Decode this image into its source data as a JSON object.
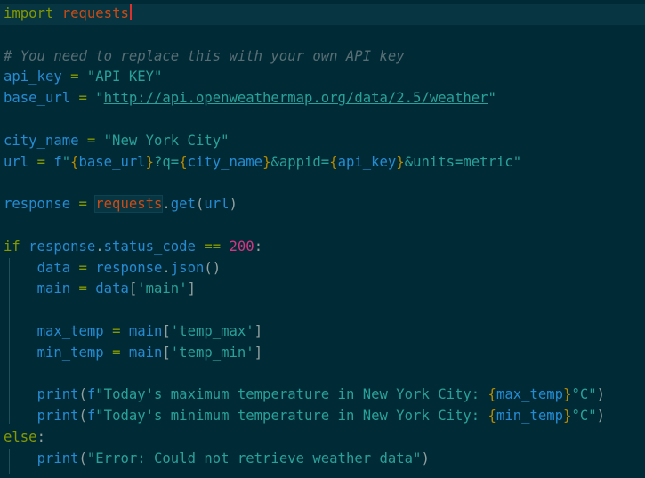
{
  "editor": {
    "line1": {
      "kw": "import",
      "module": "requests"
    },
    "line3": {
      "comment": "# You need to replace this with your own API key"
    },
    "line4": {
      "var": "api_key",
      "op": "=",
      "value": "\"API KEY\""
    },
    "line5": {
      "var": "base_url",
      "op": "=",
      "q1": "\"",
      "url": "http://api.openweathermap.org/data/2.5/weather",
      "q2": "\""
    },
    "line7": {
      "var": "city_name",
      "op": "=",
      "value": "\"New York City\""
    },
    "line8": {
      "var": "url",
      "op": "=",
      "prefix": "f",
      "s1": "\"",
      "b1o": "{",
      "v1": "base_url",
      "b1c": "}",
      "s2": "?q=",
      "b2o": "{",
      "v2": "city_name",
      "b2c": "}",
      "s3": "&appid=",
      "b3o": "{",
      "v3": "api_key",
      "b3c": "}",
      "s4": "&units=metric\""
    },
    "line10": {
      "var": "response",
      "op": "=",
      "module": "requests",
      "dot": ".",
      "fn": "get",
      "po": "(",
      "arg": "url",
      "pc": ")"
    },
    "line12": {
      "kw": "if",
      "obj": "response",
      "dot": ".",
      "attr": "status_code",
      "op": "==",
      "num": "200",
      "colon": ":"
    },
    "line13": {
      "var": "data",
      "op": "=",
      "obj": "response",
      "dot": ".",
      "fn": "json",
      "parens": "()"
    },
    "line14": {
      "var": "main",
      "op": "=",
      "obj": "data",
      "bo": "[",
      "key": "'main'",
      "bc": "]"
    },
    "line16": {
      "var": "max_temp",
      "op": "=",
      "obj": "main",
      "bo": "[",
      "key": "'temp_max'",
      "bc": "]"
    },
    "line17": {
      "var": "min_temp",
      "op": "=",
      "obj": "main",
      "bo": "[",
      "key": "'temp_min'",
      "bc": "]"
    },
    "line19": {
      "fn": "print",
      "po": "(",
      "prefix": "f",
      "s1": "\"Today's maximum temperature in New York City: ",
      "bo": "{",
      "v": "max_temp",
      "bc": "}",
      "s2": "°C\"",
      "pc": ")"
    },
    "line20": {
      "fn": "print",
      "po": "(",
      "prefix": "f",
      "s1": "\"Today's minimum temperature in New York City: ",
      "bo": "{",
      "v": "min_temp",
      "bc": "}",
      "s2": "°C\"",
      "pc": ")"
    },
    "line21": {
      "kw": "else",
      "colon": ":"
    },
    "line22": {
      "fn": "print",
      "po": "(",
      "str": "\"Error: Could not retrieve weather data\"",
      "pc": ")"
    }
  }
}
